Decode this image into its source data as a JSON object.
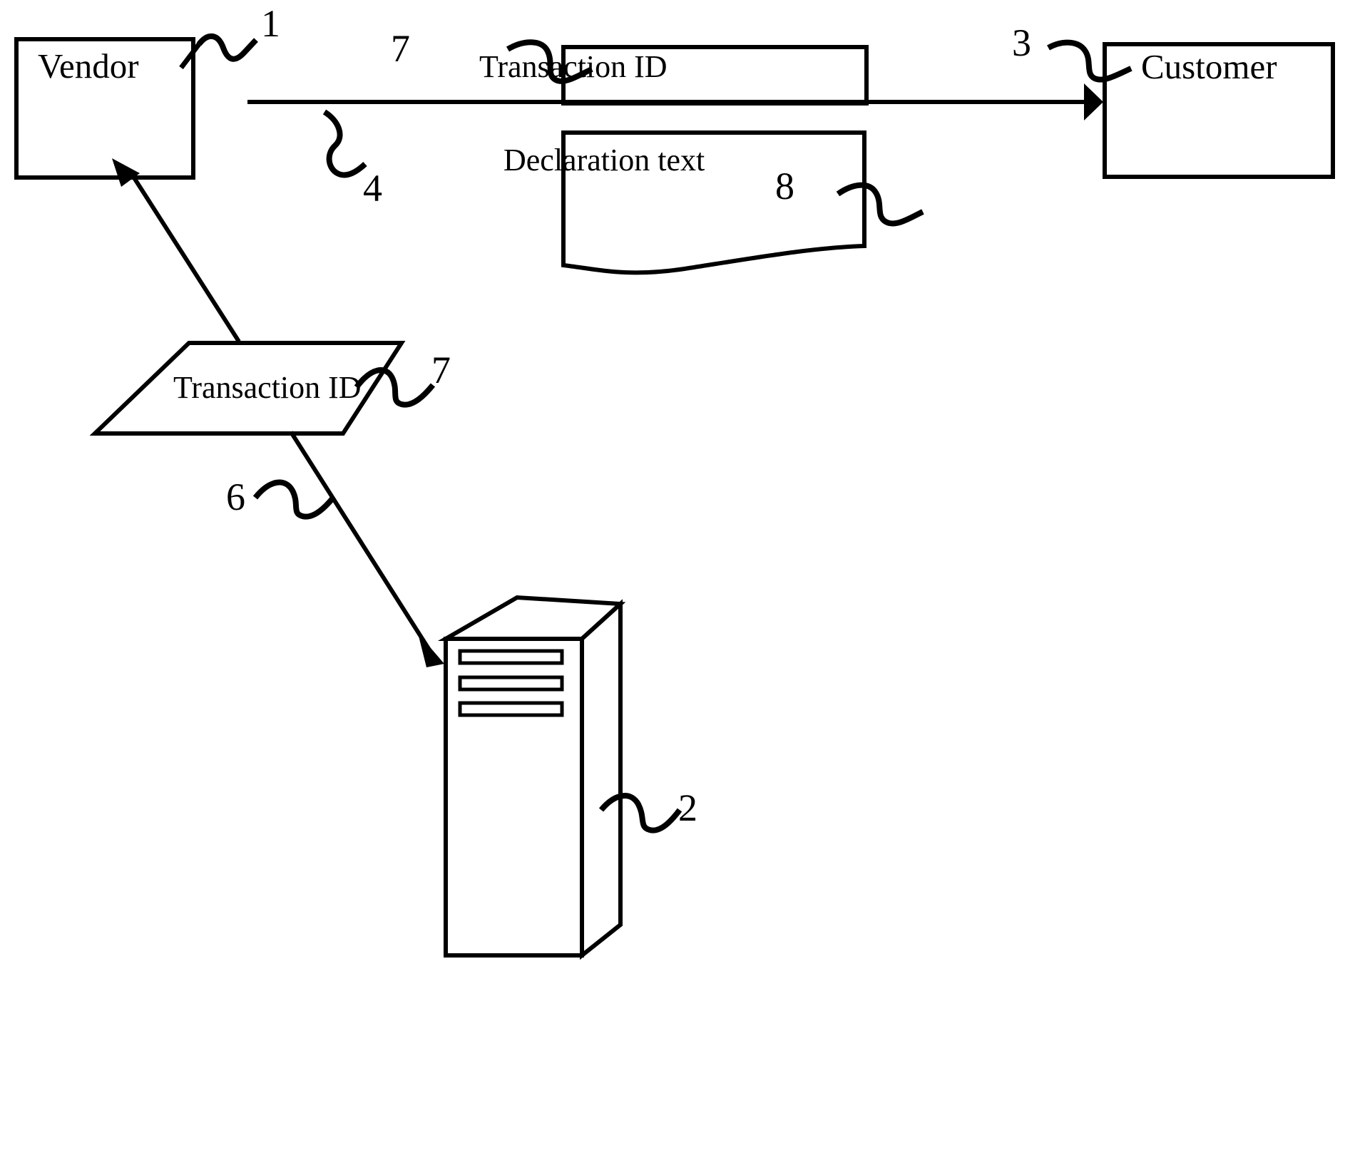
{
  "figure": {
    "type": "patent-flow-diagram",
    "background_color": "#ffffff",
    "line_color": "#000000",
    "nodes": {
      "vendor": {
        "label": "Vendor",
        "ref": "1",
        "shape": "rectangle"
      },
      "customer": {
        "label": "Customer",
        "ref": "3",
        "shape": "rectangle"
      },
      "transaction_id_box": {
        "label": "Transaction ID",
        "ref": "7",
        "shape": "rectangle"
      },
      "declaration_text_box": {
        "label": "Declaration text",
        "ref": "8",
        "shape": "torn-document"
      },
      "transaction_id_parallelogram": {
        "label": "Transaction ID",
        "ref": "7",
        "shape": "parallelogram"
      },
      "server": {
        "label": "",
        "ref": "2",
        "shape": "tower-computer"
      }
    },
    "connectors": {
      "vendor_to_customer": {
        "ref": "4",
        "style": "solid-arrow",
        "direction": "right"
      },
      "parallelogram_to_vendor": {
        "ref": "",
        "style": "solid-arrow",
        "direction": "up-left"
      },
      "parallelogram_to_server": {
        "ref": "6",
        "style": "solid-arrow",
        "direction": "down-right"
      }
    },
    "reference_numerals": [
      "1",
      "2",
      "3",
      "4",
      "6",
      "7",
      "7",
      "8"
    ]
  }
}
